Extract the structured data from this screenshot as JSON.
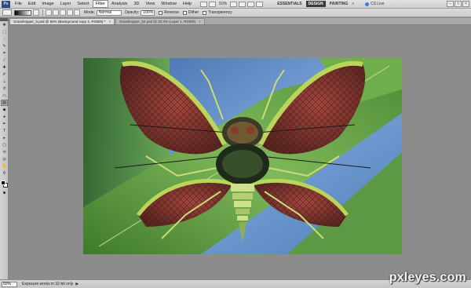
{
  "app": {
    "logo": "Ps"
  },
  "menu": [
    "File",
    "Edit",
    "Image",
    "Layer",
    "Select",
    "Filter",
    "Analysis",
    "3D",
    "View",
    "Window",
    "Help"
  ],
  "menu_active_index": 5,
  "titlebar": {
    "zoom_level": "50%"
  },
  "workspace": {
    "buttons": [
      "ESSENTIALS",
      "DESIGN",
      "PAINTING"
    ],
    "active": "DESIGN",
    "more": "»",
    "cs_live": "CS Live"
  },
  "options_bar": {
    "mode_label": "Mode:",
    "mode_value": "Normal",
    "opacity_label": "Opacity:",
    "opacity_value": "100%",
    "checks": [
      "Reverse",
      "Dither",
      "Transparency"
    ]
  },
  "tabs": [
    {
      "label": "Grasshopper_b.psd @ 50% (Background copy 2, RGB/8) *",
      "active": true
    },
    {
      "label": "Grasshopper_b2.psd @ 33.3% (Layer 1, RGB/8)",
      "active": false
    }
  ],
  "status": {
    "zoom": "50%",
    "info": "Exposure works in 32-bit only",
    "arrow": "▶"
  },
  "watermark": "pxleyes.com",
  "colors": {
    "background": "#8c8c8c",
    "artboard_sky": "#5a86c2",
    "leaf": "#5f9a3f",
    "wing": "#8b3a33",
    "body": "#1e2a1a"
  }
}
